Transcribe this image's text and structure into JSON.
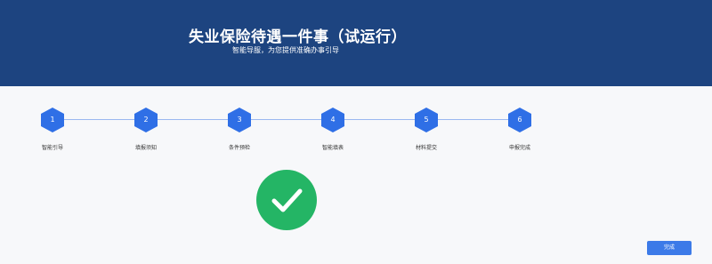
{
  "header": {
    "title": "失业保险待遇一件事（试运行）",
    "subtitle": "智能导服，为您提供准确办事引导"
  },
  "steps": [
    {
      "number": "1",
      "label": "智能引导"
    },
    {
      "number": "2",
      "label": "填报须知"
    },
    {
      "number": "3",
      "label": "条件预检"
    },
    {
      "number": "4",
      "label": "智能填表"
    },
    {
      "number": "5",
      "label": "材料提交"
    },
    {
      "number": "6",
      "label": "申报完成"
    }
  ],
  "status_icon": "checkmark-icon",
  "footer": {
    "done_label": "完成"
  },
  "colors": {
    "header_bg": "#1d4480",
    "step_active": "#2f6fe6",
    "success": "#24b565",
    "button": "#3c7ae8"
  }
}
